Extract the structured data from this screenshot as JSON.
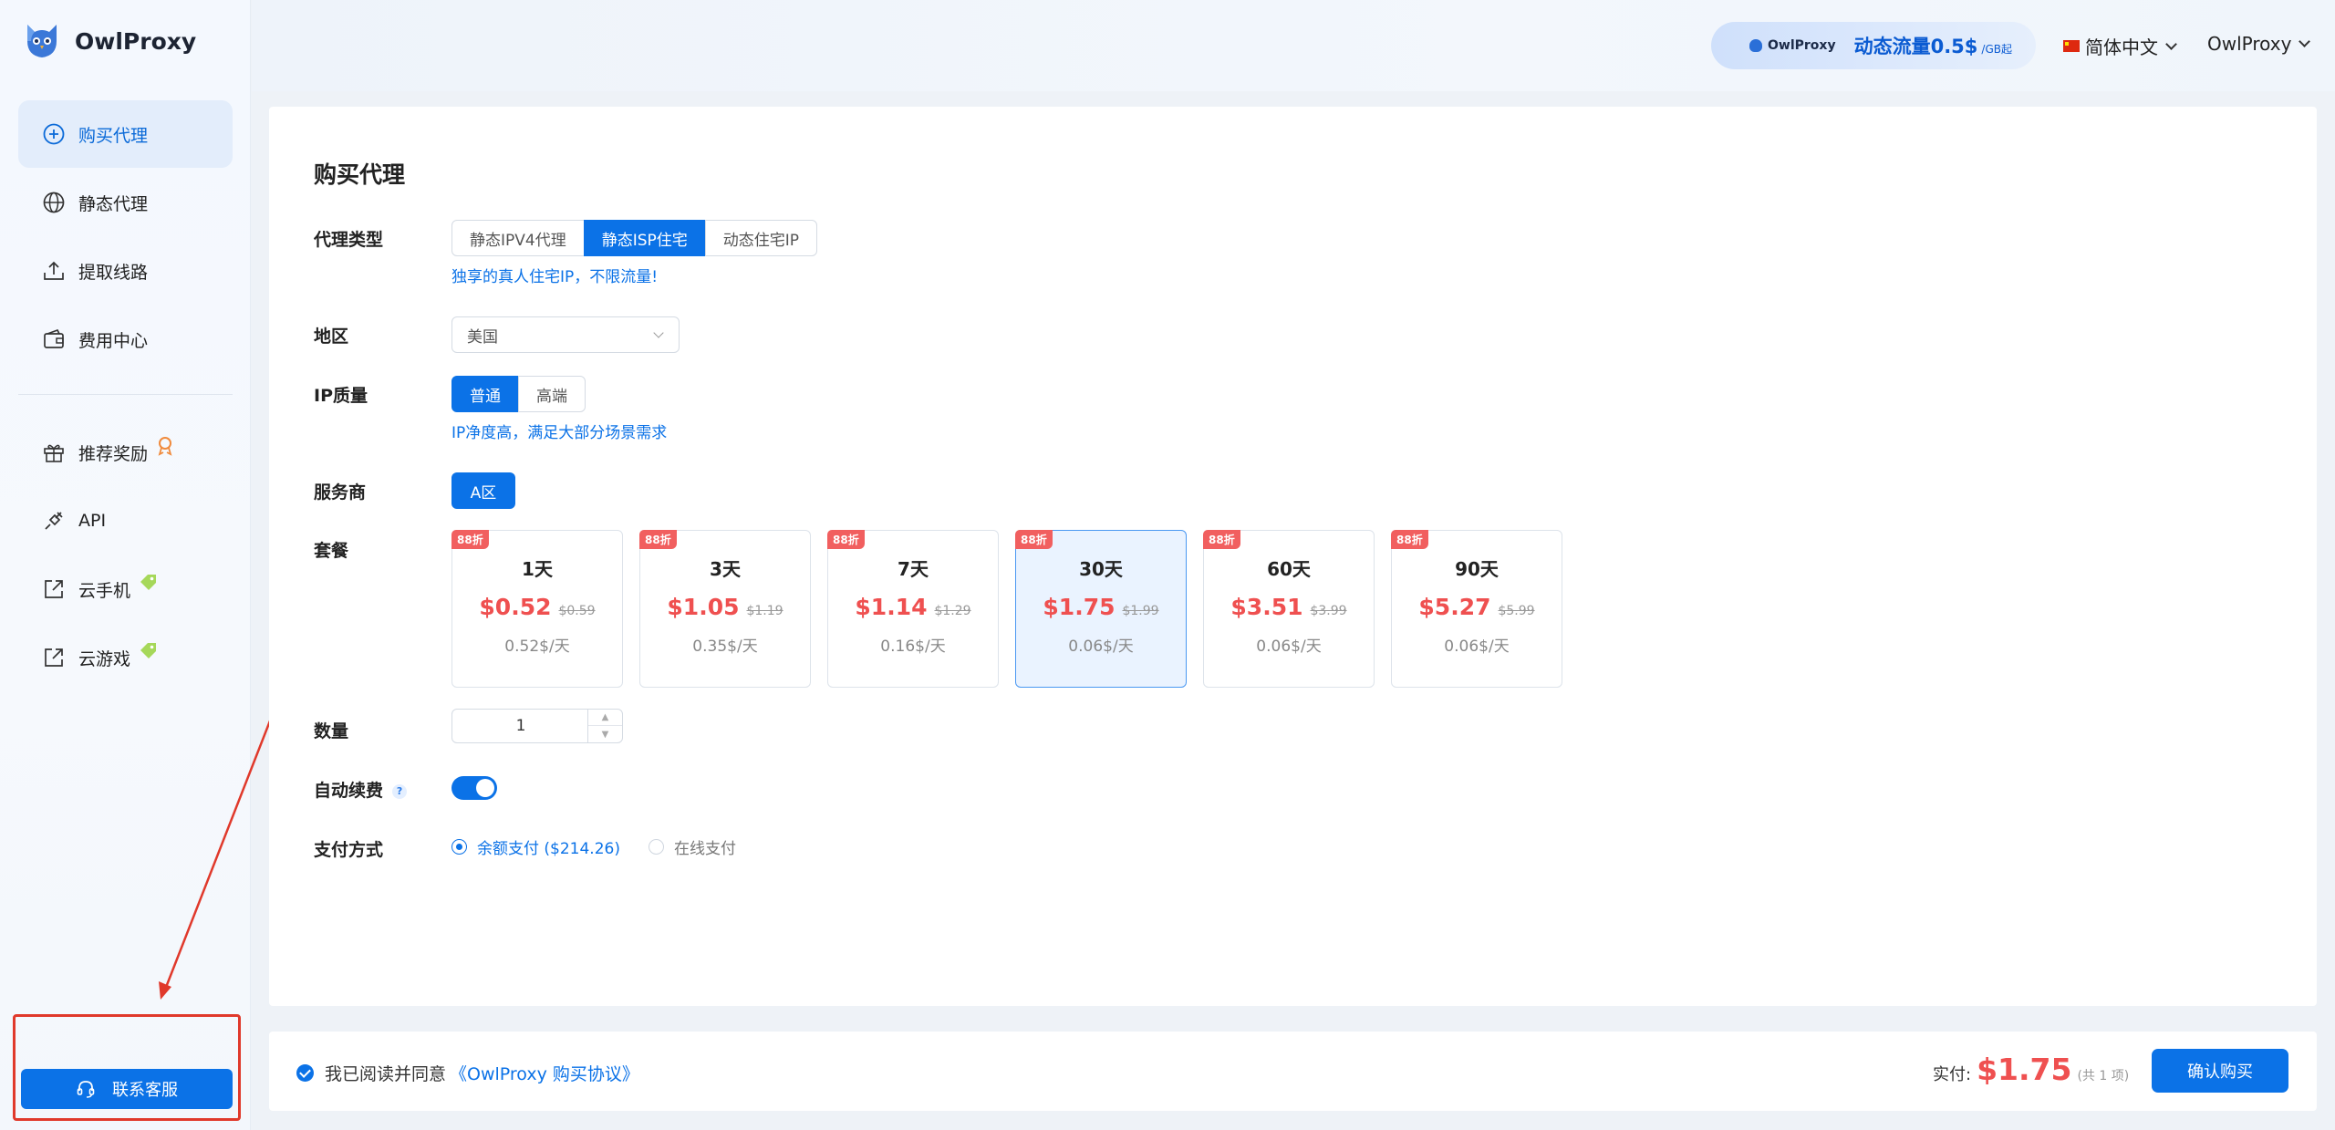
{
  "app": {
    "name": "OwlProxy"
  },
  "sidebar": {
    "items": [
      {
        "label": "购买代理",
        "icon": "plus-circle-icon",
        "active": true
      },
      {
        "label": "静态代理",
        "icon": "globe-icon"
      },
      {
        "label": "提取线路",
        "icon": "upload-icon"
      },
      {
        "label": "费用中心",
        "icon": "wallet-icon"
      }
    ],
    "items2": [
      {
        "label": "推荐奖励",
        "icon": "gift-icon",
        "badge": "medal-icon"
      },
      {
        "label": "API",
        "icon": "plug-icon"
      },
      {
        "label": "云手机",
        "icon": "share-box-icon",
        "badge": "tag-icon"
      },
      {
        "label": "云游戏",
        "icon": "share-box-icon",
        "badge": "tag-icon"
      }
    ],
    "support_label": "联系客服"
  },
  "topbar": {
    "promo_brand": "OwlProxy",
    "promo_main": "动态流量0.5$",
    "promo_sub": "/GB起",
    "language": "简体中文",
    "user": "OwlProxy"
  },
  "main": {
    "title": "购买代理",
    "proxy_type": {
      "label": "代理类型",
      "options": [
        "静态IPV4代理",
        "静态ISP住宅",
        "动态住宅IP"
      ],
      "selected": 1,
      "hint": "独享的真人住宅IP，不限流量!"
    },
    "region": {
      "label": "地区",
      "value": "美国"
    },
    "ip_quality": {
      "label": "IP质量",
      "options": [
        "普通",
        "高端"
      ],
      "selected": 0,
      "hint": "IP净度高，满足大部分场景需求"
    },
    "provider": {
      "label": "服务商",
      "value": "A区"
    },
    "plans": {
      "label": "套餐",
      "discount_tag": "88折",
      "items": [
        {
          "days": "1天",
          "price": "$0.52",
          "old": "$0.59",
          "per_day": "0.52$/天"
        },
        {
          "days": "3天",
          "price": "$1.05",
          "old": "$1.19",
          "per_day": "0.35$/天"
        },
        {
          "days": "7天",
          "price": "$1.14",
          "old": "$1.29",
          "per_day": "0.16$/天"
        },
        {
          "days": "30天",
          "price": "$1.75",
          "old": "$1.99",
          "per_day": "0.06$/天",
          "active": true
        },
        {
          "days": "60天",
          "price": "$3.51",
          "old": "$3.99",
          "per_day": "0.06$/天"
        },
        {
          "days": "90天",
          "price": "$5.27",
          "old": "$5.99",
          "per_day": "0.06$/天"
        }
      ]
    },
    "quantity": {
      "label": "数量",
      "value": "1"
    },
    "auto_renew": {
      "label": "自动续费",
      "help": "?",
      "enabled": true
    },
    "payment": {
      "label": "支付方式",
      "options": [
        "余额支付 ($214.26)",
        "在线支付"
      ],
      "selected": 0
    }
  },
  "footer": {
    "agree_text": "我已阅读并同意",
    "agree_link": "《OwlProxy 购买协议》",
    "total_label": "实付:",
    "total_amount": "$1.75",
    "total_count": "(共 1 项)",
    "buy_label": "确认购买"
  },
  "colors": {
    "primary": "#0b72e7",
    "price": "#ef5050",
    "annotation": "#e0392b"
  }
}
